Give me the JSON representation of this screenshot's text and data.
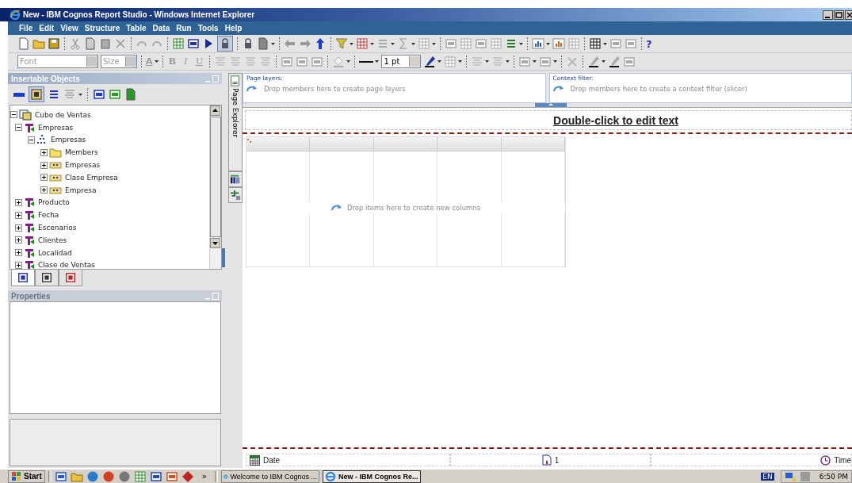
{
  "window": {
    "title": "New - IBM Cognos Report Studio - Windows Internet Explorer"
  },
  "menu": [
    "File",
    "Edit",
    "View",
    "Structure",
    "Table",
    "Data",
    "Run",
    "Tools",
    "Help"
  ],
  "format_bar": {
    "font": {
      "placeholder": "Font"
    },
    "size": {
      "placeholder": "Size"
    },
    "font_color": "A",
    "bold": "B",
    "italic": "I",
    "underline": "U",
    "border_width": {
      "value": "1 pt"
    }
  },
  "help_button": "?",
  "insertable_objects": {
    "title": "Insertable Objects",
    "active": true,
    "tree": [
      {
        "label": "Cubo de Ventas",
        "kind": "cube",
        "expanded": true,
        "children": [
          {
            "label": "Empresas",
            "kind": "dimension",
            "expanded": true,
            "children": [
              {
                "label": "Empresas",
                "kind": "hierarchy",
                "expanded": true,
                "children": [
                  {
                    "label": "Members",
                    "kind": "folder",
                    "expanded": false
                  },
                  {
                    "label": "Empresas",
                    "kind": "level",
                    "expanded": false
                  },
                  {
                    "label": "Clase Empresa",
                    "kind": "level",
                    "expanded": false
                  },
                  {
                    "label": "Empresa",
                    "kind": "level",
                    "expanded": false
                  }
                ]
              }
            ]
          },
          {
            "label": "Producto",
            "kind": "dimension",
            "expanded": false
          },
          {
            "label": "Fecha",
            "kind": "dimension",
            "expanded": false
          },
          {
            "label": "Escenarios",
            "kind": "dimension",
            "expanded": false
          },
          {
            "label": "Clientes",
            "kind": "dimension",
            "expanded": false
          },
          {
            "label": "Localidad",
            "kind": "dimension",
            "expanded": false
          },
          {
            "label": "Clase de Ventas",
            "kind": "dimension",
            "expanded": false
          }
        ]
      }
    ],
    "tabs": [
      {
        "selected": true
      },
      {
        "selected": false
      },
      {
        "selected": false
      }
    ]
  },
  "properties": {
    "title": "Properties",
    "active": false
  },
  "side_tab": {
    "label": "Page Explorer"
  },
  "page_layers": {
    "label": "Page layers:",
    "hint": "Drop members here to create page layers"
  },
  "context_filter": {
    "label": "Context filter:",
    "hint": "Drop members here to create a context filter (slicer)"
  },
  "report": {
    "title": "Double-click to edit text",
    "drop_hint": "Drop items here to create new columns"
  },
  "footer": {
    "date": "Date",
    "page": "1",
    "time": "Time"
  },
  "taskbar": {
    "start": "Start",
    "more": "»",
    "tasks": [
      {
        "label": "Welcome to IBM Cognos ...",
        "selected": false
      },
      {
        "label": "New - IBM Cognos Re...",
        "selected": true
      }
    ],
    "language": "EN",
    "clock": "6:50 PM"
  }
}
